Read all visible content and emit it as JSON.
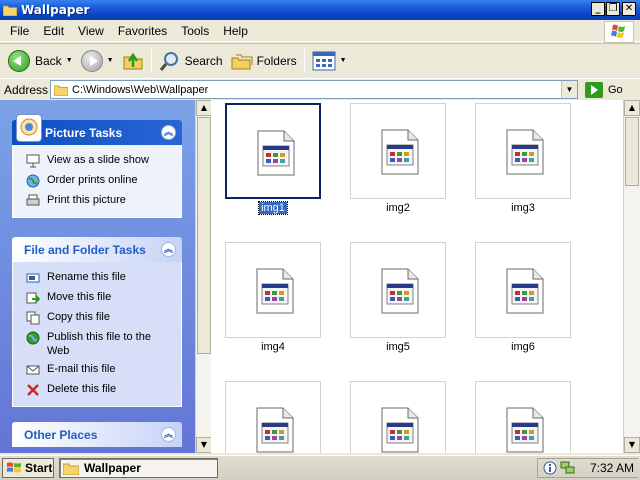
{
  "window": {
    "title": "Wallpaper",
    "min_glyph": "_",
    "max_glyph": "❐",
    "close_glyph": "✕"
  },
  "menu": [
    "File",
    "Edit",
    "View",
    "Favorites",
    "Tools",
    "Help"
  ],
  "toolbar": {
    "back_label": "Back",
    "search_label": "Search",
    "folders_label": "Folders"
  },
  "address": {
    "label": "Address",
    "path": "C:\\Windows\\Web\\Wallpaper",
    "go_label": "Go"
  },
  "task_pane": {
    "picture_tasks": {
      "title": "Picture Tasks",
      "items": [
        "View as a slide show",
        "Order prints online",
        "Print this picture"
      ]
    },
    "file_folder_tasks": {
      "title": "File and Folder Tasks",
      "items": [
        "Rename this file",
        "Move this file",
        "Copy this file",
        "Publish this file to the Web",
        "E-mail this file",
        "Delete this file"
      ]
    },
    "other_places": {
      "title": "Other Places"
    },
    "collapse_glyph": "︽"
  },
  "files": [
    {
      "name": "img1",
      "selected": true
    },
    {
      "name": "img2",
      "selected": false
    },
    {
      "name": "img3",
      "selected": false
    },
    {
      "name": "img4",
      "selected": false
    },
    {
      "name": "img5",
      "selected": false
    },
    {
      "name": "img6",
      "selected": false
    },
    {
      "name": "",
      "selected": false
    },
    {
      "name": "",
      "selected": false
    },
    {
      "name": "",
      "selected": false
    }
  ],
  "taskbar": {
    "start_label": "Start",
    "task_label": "Wallpaper",
    "clock": "7:32 AM"
  },
  "colors": {
    "title_bar": "#0a46c8",
    "task_pane_bg": "#7ba2e7",
    "selection": "#316ac5"
  }
}
